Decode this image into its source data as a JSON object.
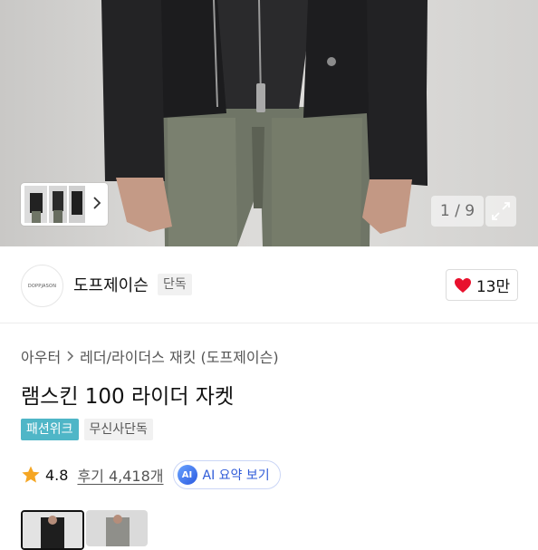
{
  "gallery": {
    "counter": "1 / 9",
    "expand_icon": "expand-icon",
    "thumb_next_icon": "chevron-right-icon"
  },
  "brand": {
    "logo_text": "DOPPJASON",
    "name": "도프제이슨",
    "badge": "단독",
    "likes": "13만",
    "like_icon": "heart-icon",
    "like_color": "#e8112d"
  },
  "product": {
    "breadcrumb": [
      "아우터",
      "레더/라이더스 재킷 (도프제이슨)"
    ],
    "title": "램스킨 100 라이더 자켓",
    "tags": [
      "패션위크",
      "무신사단독"
    ],
    "tag_accent": "#4fb6c7",
    "rating": "4.8",
    "reviews": "후기 4,418개",
    "ai_badge": "AI",
    "ai_summary": "AI 요약 보기",
    "star_color": "#f5a623"
  }
}
